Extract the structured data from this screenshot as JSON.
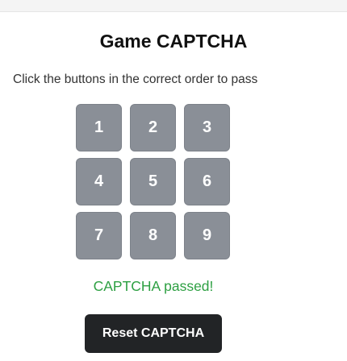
{
  "captcha": {
    "title": "Game CAPTCHA",
    "instructions": "Click the buttons in the correct order to pass",
    "keys": [
      "1",
      "2",
      "3",
      "4",
      "5",
      "6",
      "7",
      "8",
      "9"
    ],
    "status": "CAPTCHA passed!",
    "reset_label": "Reset CAPTCHA"
  },
  "colors": {
    "key_background": "#8a8f97",
    "status_success": "#2ea043",
    "reset_background": "#222426"
  }
}
